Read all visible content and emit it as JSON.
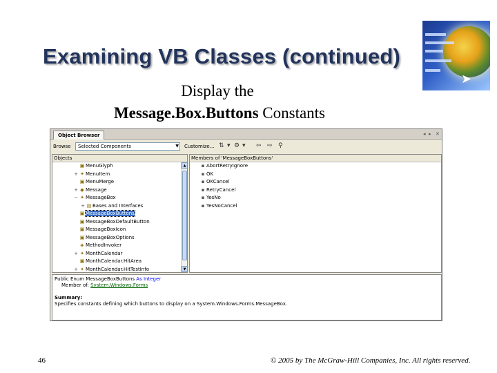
{
  "slide": {
    "title": "Examining VB Classes (continued)",
    "subtitle_line1": "Display the",
    "subtitle_bold": "Message.Box.Buttons",
    "subtitle_rest": " Constants",
    "page_number": "46",
    "copyright": "© 2005 by The McGraw-Hill Companies, Inc. All rights reserved."
  },
  "object_browser": {
    "tab_label": "Object Browser",
    "browse_label": "Browse",
    "browse_value": "Selected Components",
    "customize_label": "Customize...",
    "objects_header": "Objects",
    "members_header": "Members of 'MessageBoxButtons'",
    "objects": [
      {
        "label": "MenuGlyph",
        "expander": "",
        "icon": "enum"
      },
      {
        "label": "MenuItem",
        "expander": "⊞",
        "icon": "class"
      },
      {
        "label": "MenuMerge",
        "expander": "",
        "icon": "enum"
      },
      {
        "label": "Message",
        "expander": "⊞",
        "icon": "struct"
      },
      {
        "label": "MessageBox",
        "expander": "⊟",
        "icon": "class"
      },
      {
        "label": "Bases and Interfaces",
        "expander": "⊞",
        "icon": "folder",
        "indent": true
      },
      {
        "label": "MessageBoxButtons",
        "expander": "",
        "icon": "enum",
        "selected": true
      },
      {
        "label": "MessageBoxDefaultButton",
        "expander": "",
        "icon": "enum"
      },
      {
        "label": "MessageBoxIcon",
        "expander": "",
        "icon": "enum"
      },
      {
        "label": "MessageBoxOptions",
        "expander": "",
        "icon": "enum"
      },
      {
        "label": "MethodInvoker",
        "expander": "",
        "icon": "delegate"
      },
      {
        "label": "MonthCalendar",
        "expander": "⊞",
        "icon": "class"
      },
      {
        "label": "MonthCalendar.HitArea",
        "expander": "",
        "icon": "enum"
      },
      {
        "label": "MonthCalendar.HitTestInfo",
        "expander": "⊞",
        "icon": "class"
      }
    ],
    "members": [
      {
        "label": "AbortRetryIgnore",
        "icon": "const"
      },
      {
        "label": "OK",
        "icon": "const"
      },
      {
        "label": "OKCancel",
        "icon": "const"
      },
      {
        "label": "RetryCancel",
        "icon": "const"
      },
      {
        "label": "YesNo",
        "icon": "const"
      },
      {
        "label": "YesNoCancel",
        "icon": "const"
      }
    ],
    "description": {
      "decl_prefix": "Public Enum MessageBoxButtons",
      "decl_as": " As ",
      "decl_type": "Integer",
      "member_of_prefix": "Member of: ",
      "member_of_link": "System.Windows.Forms",
      "summary_heading": "Summary:",
      "summary_text": "Specifies constants defining which buttons to display on a System.Windows.Forms.MessageBox."
    }
  },
  "colors": {
    "title_text": "#22335c",
    "selection_bg": "#316ac5",
    "keyword": "#0000ff",
    "link": "#006400",
    "window_bg": "#ece9d8"
  }
}
